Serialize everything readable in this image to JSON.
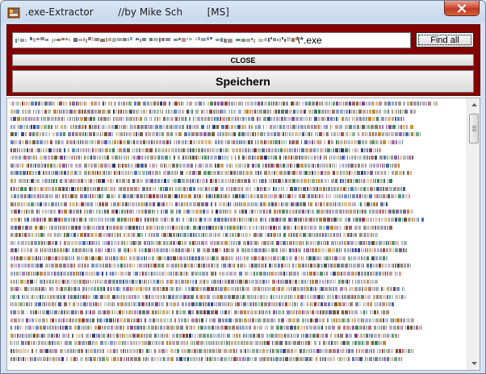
{
  "window": {
    "title": ".exe-Extractor        //by Mike Sch        [MS]"
  },
  "controls": {
    "path_value": "\\*.exe",
    "find_all_label": "Find all",
    "close_label": "CLOSE",
    "save_label": "Speichern"
  },
  "colors": {
    "panel": "#820000",
    "close_button": "#c8452e"
  },
  "output": {
    "line_count": 34
  }
}
